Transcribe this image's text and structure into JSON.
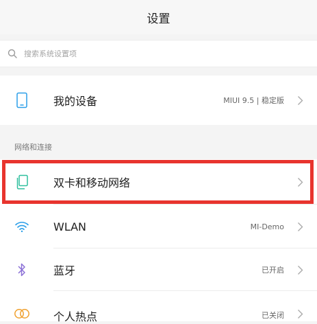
{
  "header": {
    "title": "设置"
  },
  "search": {
    "placeholder": "搜索系统设置项"
  },
  "device": {
    "label": "我的设备",
    "value": "MIUI 9.5 | 稳定版"
  },
  "section": {
    "network_title": "网络和连接"
  },
  "items": [
    {
      "label": "双卡和移动网络",
      "value": "",
      "icon": "dual-sim-icon",
      "color": "#2fbf9e"
    },
    {
      "label": "WLAN",
      "value": "MI-Demo",
      "icon": "wifi-icon",
      "color": "#2a9ee8"
    },
    {
      "label": "蓝牙",
      "value": "已开启",
      "icon": "bluetooth-icon",
      "color": "#8a6fd6"
    },
    {
      "label": "个人热点",
      "value": "已关闭",
      "icon": "hotspot-icon",
      "color": "#f0a02e"
    }
  ],
  "colors": {
    "highlight": "#e8342e",
    "device_icon": "#2a9ee8"
  }
}
